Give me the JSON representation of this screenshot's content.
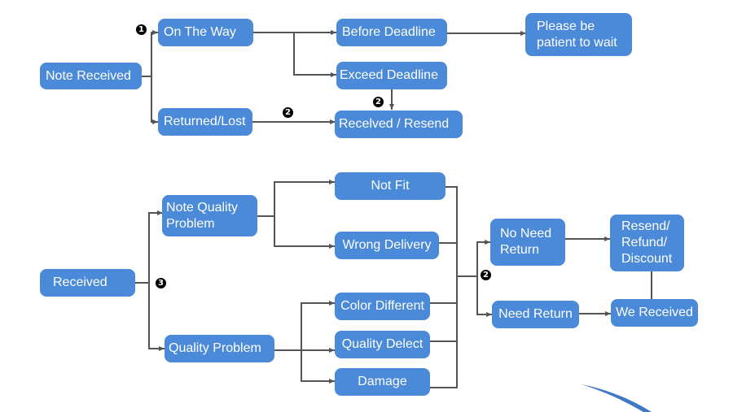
{
  "diagram": {
    "type": "flowchart",
    "section_top": {
      "nodes": {
        "note_received": "Note Received",
        "on_the_way": "On The Way",
        "returned_lost": "Returned/Lost",
        "before_deadline": "Before Deadline",
        "exceed_deadline": "Exceed Deadline",
        "received_resend": "Recelved / Resend",
        "please_wait": "Please be\npatient to wait"
      },
      "badges": {
        "step1": "1",
        "step2a": "2",
        "step2b": "2"
      }
    },
    "section_bottom": {
      "nodes": {
        "received": "Received",
        "note_quality_problem": "Note Quality\nProblem",
        "quality_problem": "Quality Problem",
        "not_fit": "Not Fit",
        "wrong_delivery": "Wrong Delivery",
        "color_different": "Color Different",
        "quality_defect": "Quality Delect",
        "damage": "Damage",
        "no_need_return": "No Need\nReturn",
        "need_return": "Need Return",
        "resend_refund_discount": "Resend/\nRefund/\nDiscount",
        "we_received": "We Received"
      },
      "badges": {
        "step3": "3",
        "step2c": "2"
      }
    },
    "colors": {
      "node_fill": "#4a8ad8",
      "connector": "#555555",
      "badge": "#000000",
      "decoration": "#3f78c4"
    }
  }
}
